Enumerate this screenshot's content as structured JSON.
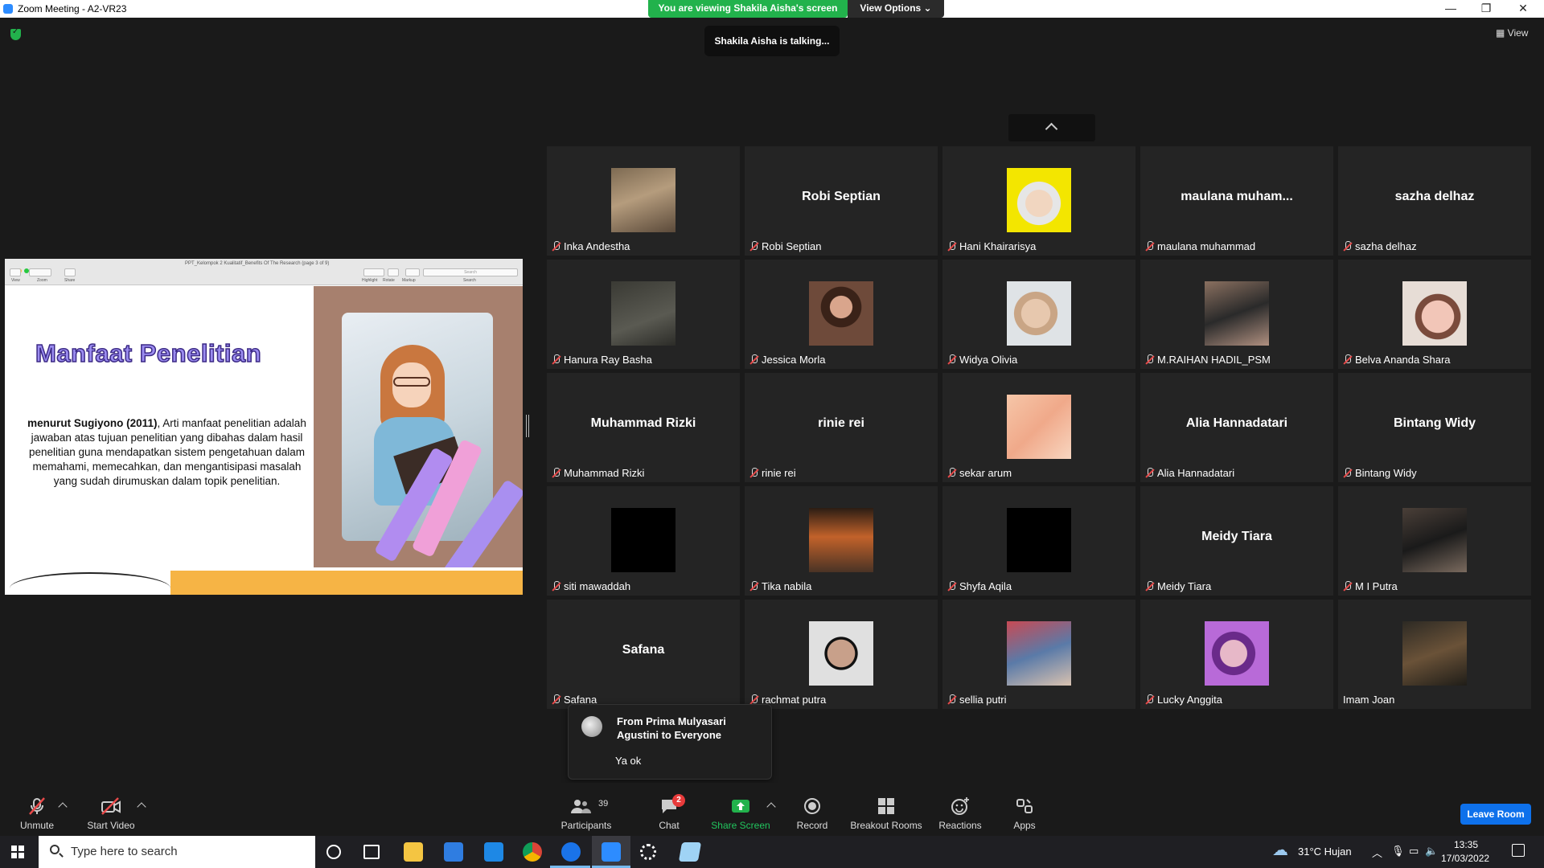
{
  "titlebar": {
    "title": "Zoom Meeting - A2-VR23",
    "minimize": "—",
    "restore": "❐",
    "close": "✕"
  },
  "banner": {
    "viewing": "You are viewing Shakila Aisha's screen",
    "view_options": "View Options ⌄",
    "talking": "Shakila Aisha is talking...",
    "view": "View"
  },
  "share": {
    "pdf_title": "PPT_Kelompok 2 Kualitatif_Benefits Of The Research (page 3 of 9)",
    "toolbar_labels": [
      "View",
      "Zoom",
      "Share",
      "Highlight",
      "Rotate",
      "Markup",
      "Search"
    ],
    "search_placeholder": "Search",
    "slide_title": "Manfaat Penelitian",
    "slide_text_bold": "menurut Sugiyono (2011)",
    "slide_text": ", Arti manfaat penelitian adalah jawaban atas tujuan penelitian yang dibahas dalam hasil penelitian guna mendapatkan sistem pengetahuan dalam memahami, memecahkan, dan mengantisipasi masalah yang sudah dirumuskan dalam topik penelitian."
  },
  "gallery": {
    "tiles": [
      {
        "name": "Inka Andestha",
        "display": "",
        "muted": true,
        "video": "forest"
      },
      {
        "name": "Robi Septian",
        "display": "Robi Septian",
        "muted": true,
        "video": ""
      },
      {
        "name": "Hani Khairarisya",
        "display": "",
        "muted": true,
        "video": "yellow"
      },
      {
        "name": "maulana muhammad",
        "display": "maulana  muham...",
        "muted": true,
        "video": ""
      },
      {
        "name": "sazha delhaz",
        "display": "sazha delhaz",
        "muted": true,
        "video": ""
      },
      {
        "name": "Hanura Ray Basha",
        "display": "",
        "muted": true,
        "video": "dark"
      },
      {
        "name": "Jessica Morla",
        "display": "",
        "muted": true,
        "video": "doll"
      },
      {
        "name": "Widya Olivia",
        "display": "",
        "muted": true,
        "video": "face"
      },
      {
        "name": "M.RAIHAN HADIL_PSM",
        "display": "",
        "muted": true,
        "video": "group"
      },
      {
        "name": "Belva Ananda Shara",
        "display": "",
        "muted": true,
        "video": "flower"
      },
      {
        "name": "Muhammad Rizki",
        "display": "Muhammad Rizki",
        "muted": true,
        "video": ""
      },
      {
        "name": "rinie rei",
        "display": "rinie rei",
        "muted": true,
        "video": ""
      },
      {
        "name": "sekar arum",
        "display": "",
        "muted": true,
        "video": "peach"
      },
      {
        "name": "Alia Hannadatari",
        "display": "Alia Hannadatari",
        "muted": true,
        "video": ""
      },
      {
        "name": "Bintang Widy",
        "display": "Bintang Widy",
        "muted": true,
        "video": ""
      },
      {
        "name": "siti mawaddah",
        "display": "",
        "muted": true,
        "video": "black"
      },
      {
        "name": "Tika nabila",
        "display": "",
        "muted": true,
        "video": "bear"
      },
      {
        "name": "Shyfa Aqila",
        "display": "",
        "muted": true,
        "video": "black"
      },
      {
        "name": "Meidy Tiara",
        "display": "Meidy Tiara",
        "muted": true,
        "video": ""
      },
      {
        "name": "M I Putra",
        "display": "",
        "muted": true,
        "video": "mirror"
      },
      {
        "name": "Safana",
        "display": "Safana",
        "muted": true,
        "video": ""
      },
      {
        "name": "rachmat putra",
        "display": "",
        "muted": true,
        "video": "sunglasses"
      },
      {
        "name": "sellia putri",
        "display": "",
        "muted": true,
        "video": "shop"
      },
      {
        "name": "Lucky Anggita",
        "display": "",
        "muted": true,
        "video": "purple"
      },
      {
        "name": "Imam Joan",
        "display": "",
        "muted": false,
        "video": "night"
      }
    ]
  },
  "chat_popup": {
    "from": "From Prima Mulyasari Agustini to Everyone",
    "message": "Ya ok"
  },
  "toolbar": {
    "unmute": "Unmute",
    "start_video": "Start Video",
    "participants": "Participants",
    "participants_count": "39",
    "chat": "Chat",
    "chat_badge": "2",
    "share_screen": "Share Screen",
    "record": "Record",
    "breakout_rooms": "Breakout Rooms",
    "reactions": "Reactions",
    "apps": "Apps",
    "leave": "Leave Room"
  },
  "taskbar": {
    "search_placeholder": "Type here to search",
    "weather": "31°C  Hujan",
    "time": "13:35",
    "date": "17/03/2022"
  },
  "colors": {
    "green_banner": "#22b24c",
    "leave_blue": "#0e71eb",
    "tile_bg": "#242424",
    "muted_red": "#e84a4a"
  }
}
